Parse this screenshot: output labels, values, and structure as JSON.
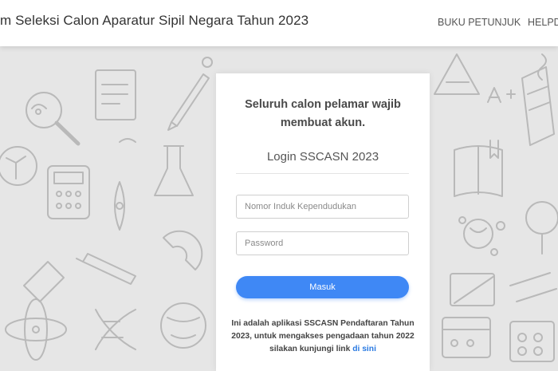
{
  "header": {
    "brand": "m Seleksi Calon Aparatur Sipil Negara Tahun 2023",
    "nav": [
      {
        "label": "BUKU PETUNJUK"
      },
      {
        "label": "HELPD"
      }
    ]
  },
  "login": {
    "headline_line1": "Seluruh calon pelamar wajib",
    "headline_line2": "membuat akun.",
    "title": "Login SSCASN 2023",
    "nik_placeholder": "Nomor Induk Kependudukan",
    "password_placeholder": "Password",
    "submit_label": "Masuk",
    "info_text": "Ini adalah aplikasi SSCASN Pendaftaran Tahun 2023, untuk mengakses pengadaan tahun 2022 silakan kunjungi link ",
    "info_link": "di sini"
  },
  "colors": {
    "accent": "#3f88f5",
    "link": "#2a7ae2",
    "background_doodle": "#e6e6e6"
  }
}
